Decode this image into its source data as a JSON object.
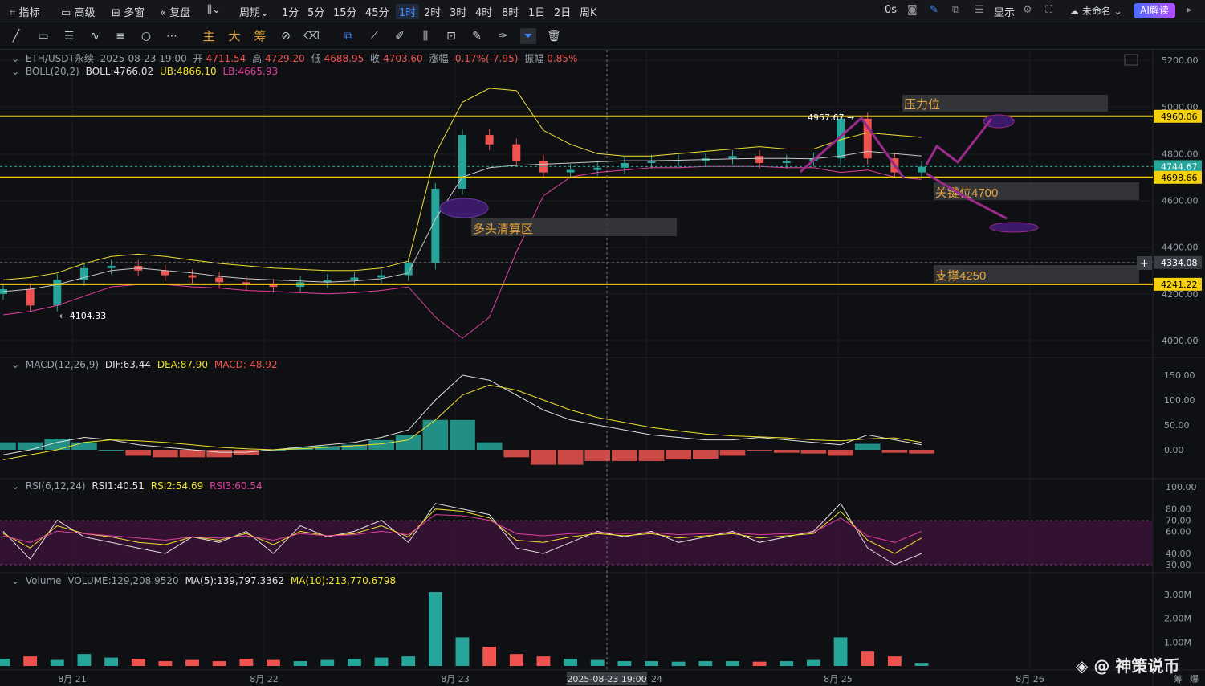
{
  "topbar": {
    "indicators": "指标",
    "advanced": "高级",
    "multi_window": "多窗",
    "replay": "复盘",
    "period": "周期",
    "intervals": [
      "1分",
      "5分",
      "15分",
      "45分",
      "1时",
      "2时",
      "3时",
      "4时",
      "8时",
      "1日",
      "2日",
      "周K"
    ],
    "active_interval": "1时",
    "countdown": "0s",
    "display": "显示",
    "account": "未命名",
    "ai_button": "AI解读"
  },
  "toolbar": {
    "main": "主",
    "big": "大",
    "chips": "筹"
  },
  "legend_main": {
    "symbol": "ETH/USDT永续",
    "time": "2025-08-23 19:00",
    "open_label": "开",
    "open": "4711.54",
    "high_label": "高",
    "high": "4729.20",
    "low_label": "低",
    "low": "4688.95",
    "close_label": "收",
    "close": "4703.60",
    "change_label": "涨幅",
    "change": "-0.17%(-7.95)",
    "amp_label": "振幅",
    "amp": "0.85%"
  },
  "legend_boll": {
    "name": "BOLL(20,2)",
    "boll": "BOLL:4766.02",
    "ub": "UB:4866.10",
    "lb": "LB:4665.93"
  },
  "legend_macd": {
    "name": "MACD(12,26,9)",
    "dif": "DIF:63.44",
    "dea": "DEA:87.90",
    "macd": "MACD:-48.92"
  },
  "legend_rsi": {
    "name": "RSI(6,12,24)",
    "rsi1": "RSI1:40.51",
    "rsi2": "RSI2:54.69",
    "rsi3": "RSI3:60.54"
  },
  "legend_vol": {
    "name": "Volume",
    "volume": "VOLUME:129,208.9520",
    "ma5": "MA(5):139,797.3362",
    "ma10": "MA(10):213,770.6798"
  },
  "annotations": {
    "pressure": "压力位",
    "key_level": "关键位4700",
    "long_liq": "多头清算区",
    "support": "支撑4250",
    "high_mark": "4957.67",
    "low_mark": "4104.33"
  },
  "price_axis": [
    "5200.00",
    "5000.00",
    "4800.00",
    "4600.00",
    "4400.00",
    "4200.00",
    "4000.00"
  ],
  "price_badges": {
    "line_top": "4960.06",
    "current": "4744.67",
    "line_mid": "4698.66",
    "crosshair": "4334.08",
    "line_bottom": "4241.22"
  },
  "macd_axis": [
    "150.00",
    "100.00",
    "50.00",
    "0.00"
  ],
  "rsi_axis": [
    "100.00",
    "80.00",
    "70.00",
    "60.00",
    "40.00",
    "30.00"
  ],
  "vol_axis": [
    "3.00M",
    "2.00M",
    "1.00M"
  ],
  "time_axis": [
    "8月 21",
    "8月 22",
    "8月 23",
    "24",
    "8月 25",
    "8月 26"
  ],
  "crosshair_time": "2025-08-23 19:00",
  "bottom_right": [
    "筹",
    "爆"
  ],
  "watermark": "@ 神策说币",
  "colors": {
    "up": "#26a69a",
    "down": "#ef5350",
    "yellow_line": "#f5d00f",
    "ub": "#f0e030",
    "mid": "#c8c8c8",
    "lb": "#e040a0",
    "purple": "#9b2a8a",
    "accent": "#3d8bff"
  },
  "chart_data": {
    "type": "line",
    "boll_upper": [
      4260,
      4270,
      4290,
      4330,
      4360,
      4370,
      4360,
      4345,
      4330,
      4320,
      4310,
      4305,
      4300,
      4300,
      4310,
      4340,
      4800,
      5020,
      5080,
      5070,
      4900,
      4840,
      4800,
      4790,
      4790,
      4800,
      4810,
      4820,
      4830,
      4820,
      4820,
      4860,
      4890,
      4880,
      4870
    ],
    "boll_mid": [
      4210,
      4220,
      4240,
      4270,
      4300,
      4310,
      4300,
      4290,
      4275,
      4265,
      4260,
      4255,
      4250,
      4255,
      4265,
      4290,
      4520,
      4700,
      4740,
      4750,
      4755,
      4760,
      4765,
      4770,
      4770,
      4772,
      4775,
      4778,
      4780,
      4780,
      4778,
      4790,
      4810,
      4800,
      4790
    ],
    "boll_lower": [
      4110,
      4125,
      4150,
      4190,
      4230,
      4240,
      4240,
      4230,
      4225,
      4215,
      4210,
      4205,
      4200,
      4205,
      4215,
      4230,
      4100,
      4010,
      4100,
      4380,
      4620,
      4700,
      4720,
      4730,
      4740,
      4740,
      4745,
      4745,
      4745,
      4740,
      4740,
      4720,
      4730,
      4700,
      4690
    ],
    "closes": [
      4220,
      4150,
      4260,
      4310,
      4320,
      4300,
      4280,
      4270,
      4250,
      4240,
      4230,
      4250,
      4260,
      4270,
      4280,
      4330,
      4650,
      4880,
      4840,
      4770,
      4720,
      4730,
      4740,
      4760,
      4770,
      4770,
      4780,
      4790,
      4760,
      4770,
      4780,
      4950,
      4780,
      4720,
      4744
    ],
    "macd_dif": [
      -10,
      0,
      15,
      25,
      20,
      10,
      5,
      0,
      -5,
      -5,
      0,
      5,
      10,
      15,
      25,
      40,
      100,
      150,
      140,
      110,
      80,
      60,
      50,
      40,
      30,
      25,
      20,
      20,
      25,
      20,
      15,
      10,
      30,
      20,
      10
    ],
    "macd_dea": [
      -20,
      -10,
      0,
      15,
      20,
      18,
      15,
      10,
      5,
      2,
      0,
      2,
      5,
      8,
      12,
      20,
      60,
      110,
      130,
      120,
      100,
      80,
      65,
      55,
      45,
      38,
      32,
      28,
      26,
      24,
      20,
      18,
      22,
      24,
      15
    ],
    "rsi1": [
      60,
      35,
      70,
      55,
      50,
      45,
      40,
      55,
      50,
      60,
      40,
      65,
      55,
      60,
      70,
      50,
      85,
      80,
      75,
      45,
      40,
      50,
      60,
      55,
      60,
      50,
      55,
      60,
      50,
      55,
      60,
      85,
      45,
      30,
      40
    ],
    "rsi2": [
      58,
      45,
      65,
      58,
      55,
      50,
      48,
      55,
      52,
      58,
      48,
      60,
      56,
      58,
      65,
      55,
      80,
      78,
      72,
      52,
      50,
      55,
      58,
      56,
      58,
      54,
      56,
      58,
      54,
      56,
      58,
      78,
      52,
      40,
      54
    ],
    "rsi3": [
      56,
      50,
      60,
      58,
      56,
      54,
      52,
      55,
      54,
      56,
      52,
      58,
      56,
      57,
      60,
      57,
      75,
      74,
      70,
      58,
      56,
      58,
      59,
      58,
      59,
      57,
      58,
      59,
      57,
      58,
      59,
      72,
      56,
      50,
      60
    ],
    "volume": [
      0.3,
      0.4,
      0.25,
      0.5,
      0.35,
      0.3,
      0.2,
      0.25,
      0.2,
      0.3,
      0.25,
      0.2,
      0.25,
      0.3,
      0.35,
      0.4,
      3.1,
      1.2,
      0.8,
      0.5,
      0.4,
      0.3,
      0.25,
      0.2,
      0.2,
      0.18,
      0.2,
      0.2,
      0.18,
      0.2,
      0.25,
      1.2,
      0.6,
      0.4,
      0.13
    ]
  }
}
